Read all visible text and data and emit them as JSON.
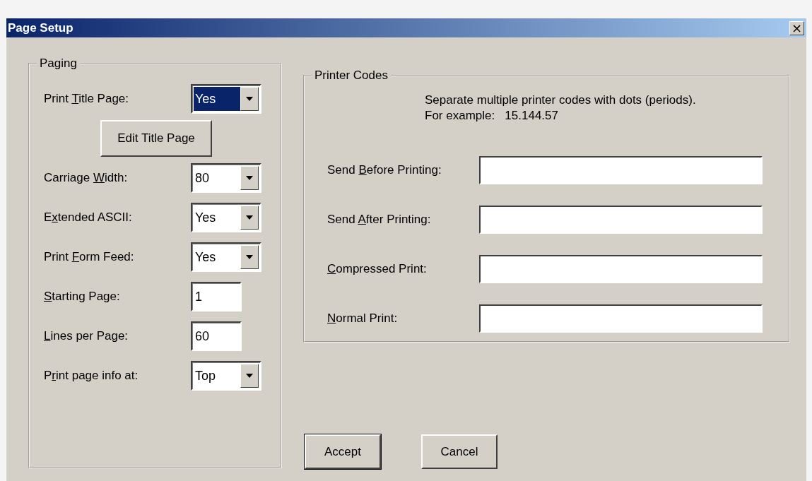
{
  "window": {
    "title": "Page Setup",
    "close": "×"
  },
  "paging": {
    "title": "Paging",
    "items": [
      {
        "kind": "select",
        "label": {
          "before": "Print ",
          "key": "T",
          "after": "itle Page:"
        },
        "value": "Yes",
        "focused": true
      },
      {
        "kind": "button",
        "text": "Edit Title Page"
      },
      {
        "kind": "select",
        "label": {
          "before": "Carriage ",
          "key": "W",
          "after": "idth:"
        },
        "value": "80",
        "focused": false
      },
      {
        "kind": "select",
        "label": {
          "before": "E",
          "key": "x",
          "after": "tended ASCII:"
        },
        "value": "Yes",
        "focused": false
      },
      {
        "kind": "select",
        "label": {
          "before": "Print ",
          "key": "F",
          "after": "orm Feed:"
        },
        "value": "Yes",
        "focused": false
      },
      {
        "kind": "text",
        "label": {
          "key": "S",
          "after": "tarting Page:"
        },
        "value": "1",
        "focused": false
      },
      {
        "kind": "text",
        "label": {
          "key": "L",
          "after": "ines per Page:"
        },
        "value": "60",
        "focused": false
      },
      {
        "kind": "select",
        "label": {
          "before": "P",
          "key": "r",
          "after": "int page info at:"
        },
        "value": "Top",
        "focused": false
      }
    ]
  },
  "printer_codes": {
    "title": "Printer Codes",
    "note": [
      "Separate multiple printer codes with dots (periods).",
      "For example:   15.144.57"
    ],
    "fields": [
      {
        "label": {
          "before": "Send ",
          "key": "B",
          "after": "efore Printing:"
        }
      },
      {
        "label": {
          "before": "Send ",
          "key": "A",
          "after": "fter Printing:"
        }
      },
      {
        "label": {
          "key": "C",
          "after": "ompressed Print:"
        }
      },
      {
        "label": {
          "key": "N",
          "after": "ormal Print:"
        }
      }
    ]
  },
  "buttons": [
    {
      "text": "Accept",
      "default": true
    },
    {
      "text": "Cancel",
      "default": false
    }
  ]
}
